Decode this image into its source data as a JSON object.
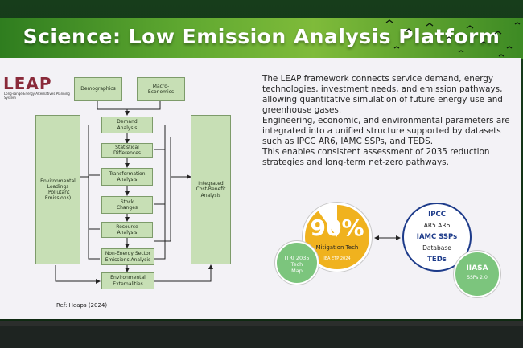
{
  "slide": {
    "title": "Science: Low Emission Analysis Platform",
    "logo": {
      "text_main": "LEAP",
      "tagline": "Long-range Energy Alternatives Planning System"
    },
    "reference": "Ref: Heaps (2024)",
    "diagram": {
      "demographics": "Demographics",
      "macro": "Macro-\nEconomics",
      "demand": "Demand\nAnalysis",
      "statistical": "Statistical\nDifferences",
      "transformation": "Transformation\nAnalysis",
      "stock": "Stock\nChanges",
      "resource": "Resource\nAnalysis",
      "non_energy": "Non-Energy Sector\nEmissions Analysis",
      "environmental_loadings": "Environmental\nLoadings\n(Pollutant\nEmissions)",
      "integrated": "Integrated\nCost-Benefit\nAnalysis",
      "externalities": "Environmental\nExternalities"
    },
    "paragraphs": [
      "The LEAP framework connects service demand, energy technologies, investment needs, and emission pathways, allowing quantitative simulation of future energy use and greenhouse gases.",
      "Engineering, economic, and environmental parameters are integrated into a unified structure supported by datasets such as IPCC AR6, IAMC SSPs, and TEDS.",
      "This enables consistent assessment of 2035 reduction strategies and long-term net-zero pathways."
    ],
    "mitigation": {
      "percent": "90%",
      "label": "Mitigation Tech",
      "source": "IEA ETP 2024",
      "progress": 0.9
    },
    "itri": {
      "line1": "ITRI 2035",
      "line2": "Tech",
      "line3": "Map"
    },
    "database": {
      "ipcc": "IPCC",
      "ar": "AR5 AR6",
      "iamc": "IAMC SSPs",
      "db": "Database",
      "teds": "TEDs"
    },
    "iiasa": {
      "name": "IIASA",
      "version": "SSPs 2.0"
    },
    "colors": {
      "accent_green": "#5fa830",
      "box_green": "#c7dfb5",
      "gold": "#f0b21e",
      "navy": "#1d3b8a"
    }
  }
}
